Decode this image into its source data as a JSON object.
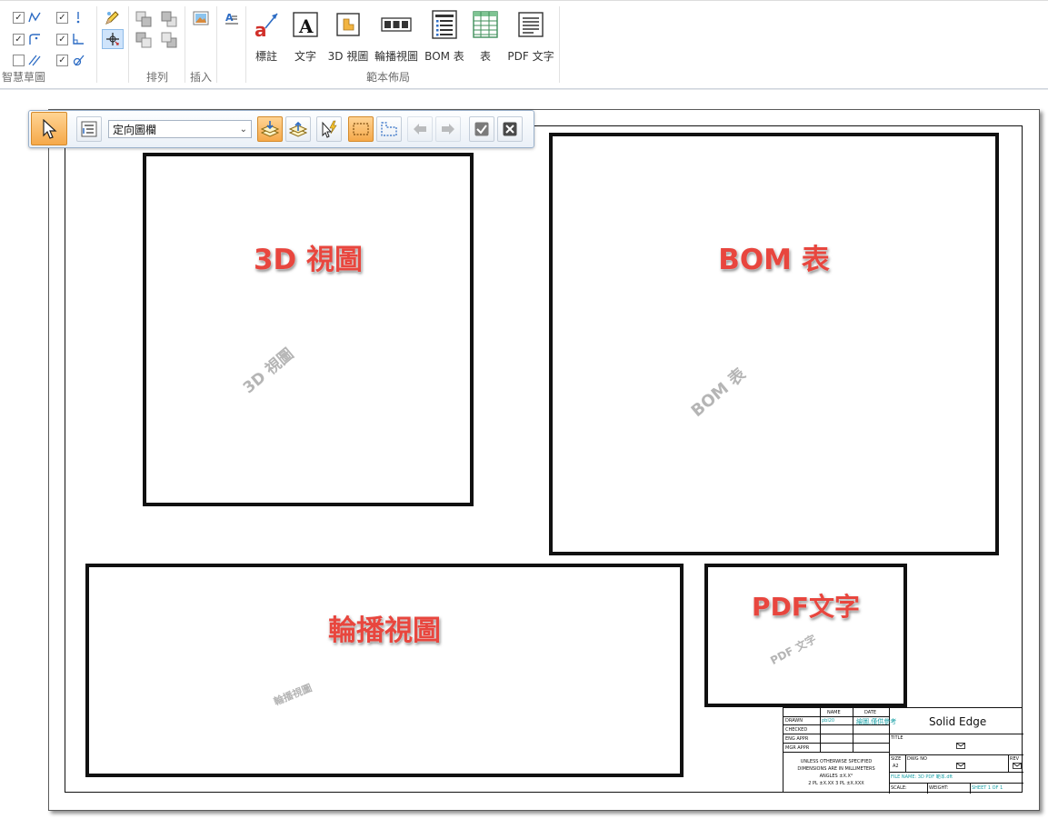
{
  "ribbon": {
    "groups": {
      "smart_sketch": "智慧草圖",
      "arrange": "排列",
      "insert": "插入",
      "template_layout": "範本佈局"
    },
    "buttons": {
      "annotation": "標註",
      "text": "文字",
      "view_3d": "3D 視圖",
      "carousel_view": "輪播視圖",
      "bom_table": "BOM 表",
      "table": "表",
      "pdf_text": "PDF 文字"
    },
    "smart_sketch_checks": [
      true,
      true,
      true,
      true,
      false,
      true
    ]
  },
  "command_bar": {
    "dropdown_value": "定向圖欄"
  },
  "frames": {
    "view_3d": {
      "title": "3D 視圖",
      "watermark": "3D 視圖"
    },
    "bom": {
      "title": "BOM 表",
      "watermark": "BOM 表"
    },
    "carousel": {
      "title": "輪播視圖",
      "watermark": "輪播視圖"
    },
    "pdf": {
      "title": "PDF文字",
      "watermark": "PDF 文字"
    }
  },
  "title_block": {
    "name_header": "NAME",
    "date_header": "DATE",
    "drawn": "DRAWN",
    "drawn_name": "pbl20",
    "drawn_date": "繪圖,僅供參考",
    "checked": "CHECKED",
    "eng_appr": "ENG APPR",
    "mgr_appr": "MGR APPR",
    "company": "Solid Edge",
    "title_label": "TITLE",
    "note": [
      "UNLESS OTHERWISE SPECIFIED",
      "DIMENSIONS ARE IN MILLIMETERS",
      "ANGLES ±X.X°",
      "2 PL ±X.XX 3 PL ±X.XXX"
    ],
    "size_label": "SIZE",
    "size_value": "A2",
    "dwg_no_label": "DWG NO",
    "rev_label": "REV",
    "file_name": "FILE NAME: 3D PDF 範本.dft",
    "scale_label": "SCALE:",
    "weight_label": "WEIGHT:",
    "sheet_label": "SHEET 1 OF 1"
  }
}
